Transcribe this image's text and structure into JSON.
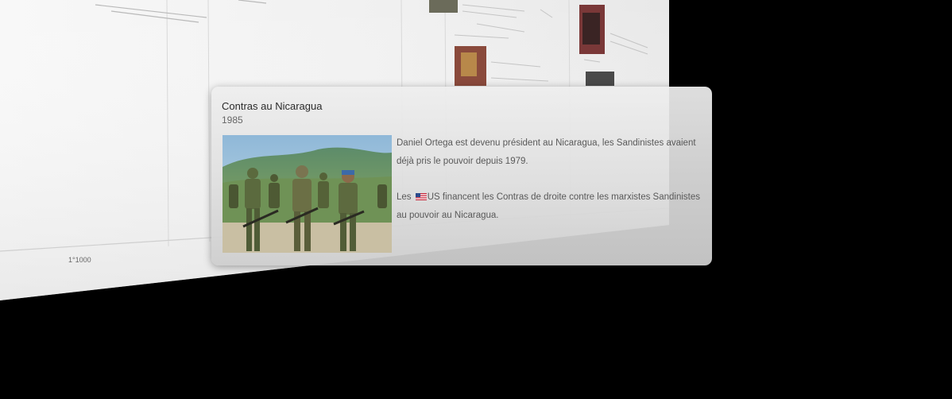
{
  "card": {
    "title": "Contras au Nicaragua",
    "year": "1985",
    "paragraph_1": "Daniel Ortega est devenu président au Nicaragua, les Sandinistes avaient déjà pris le pouvoir depuis 1979.",
    "paragraph_2_prefix": "Les ",
    "paragraph_2_country": "US",
    "paragraph_2_rest": " financent les Contras de droite contre les marxistes Sandinistes au pouvoir au Nicaragua.",
    "photo_icon": "soldiers-photo",
    "flag_icon": "us-flag-icon"
  },
  "timeline": {
    "axis_label": "1°1000"
  },
  "colors": {
    "background": "#000000",
    "page": "#f4f4f4",
    "card": "#e6e6e6",
    "text": "#595959",
    "title": "#2a2a2a"
  }
}
